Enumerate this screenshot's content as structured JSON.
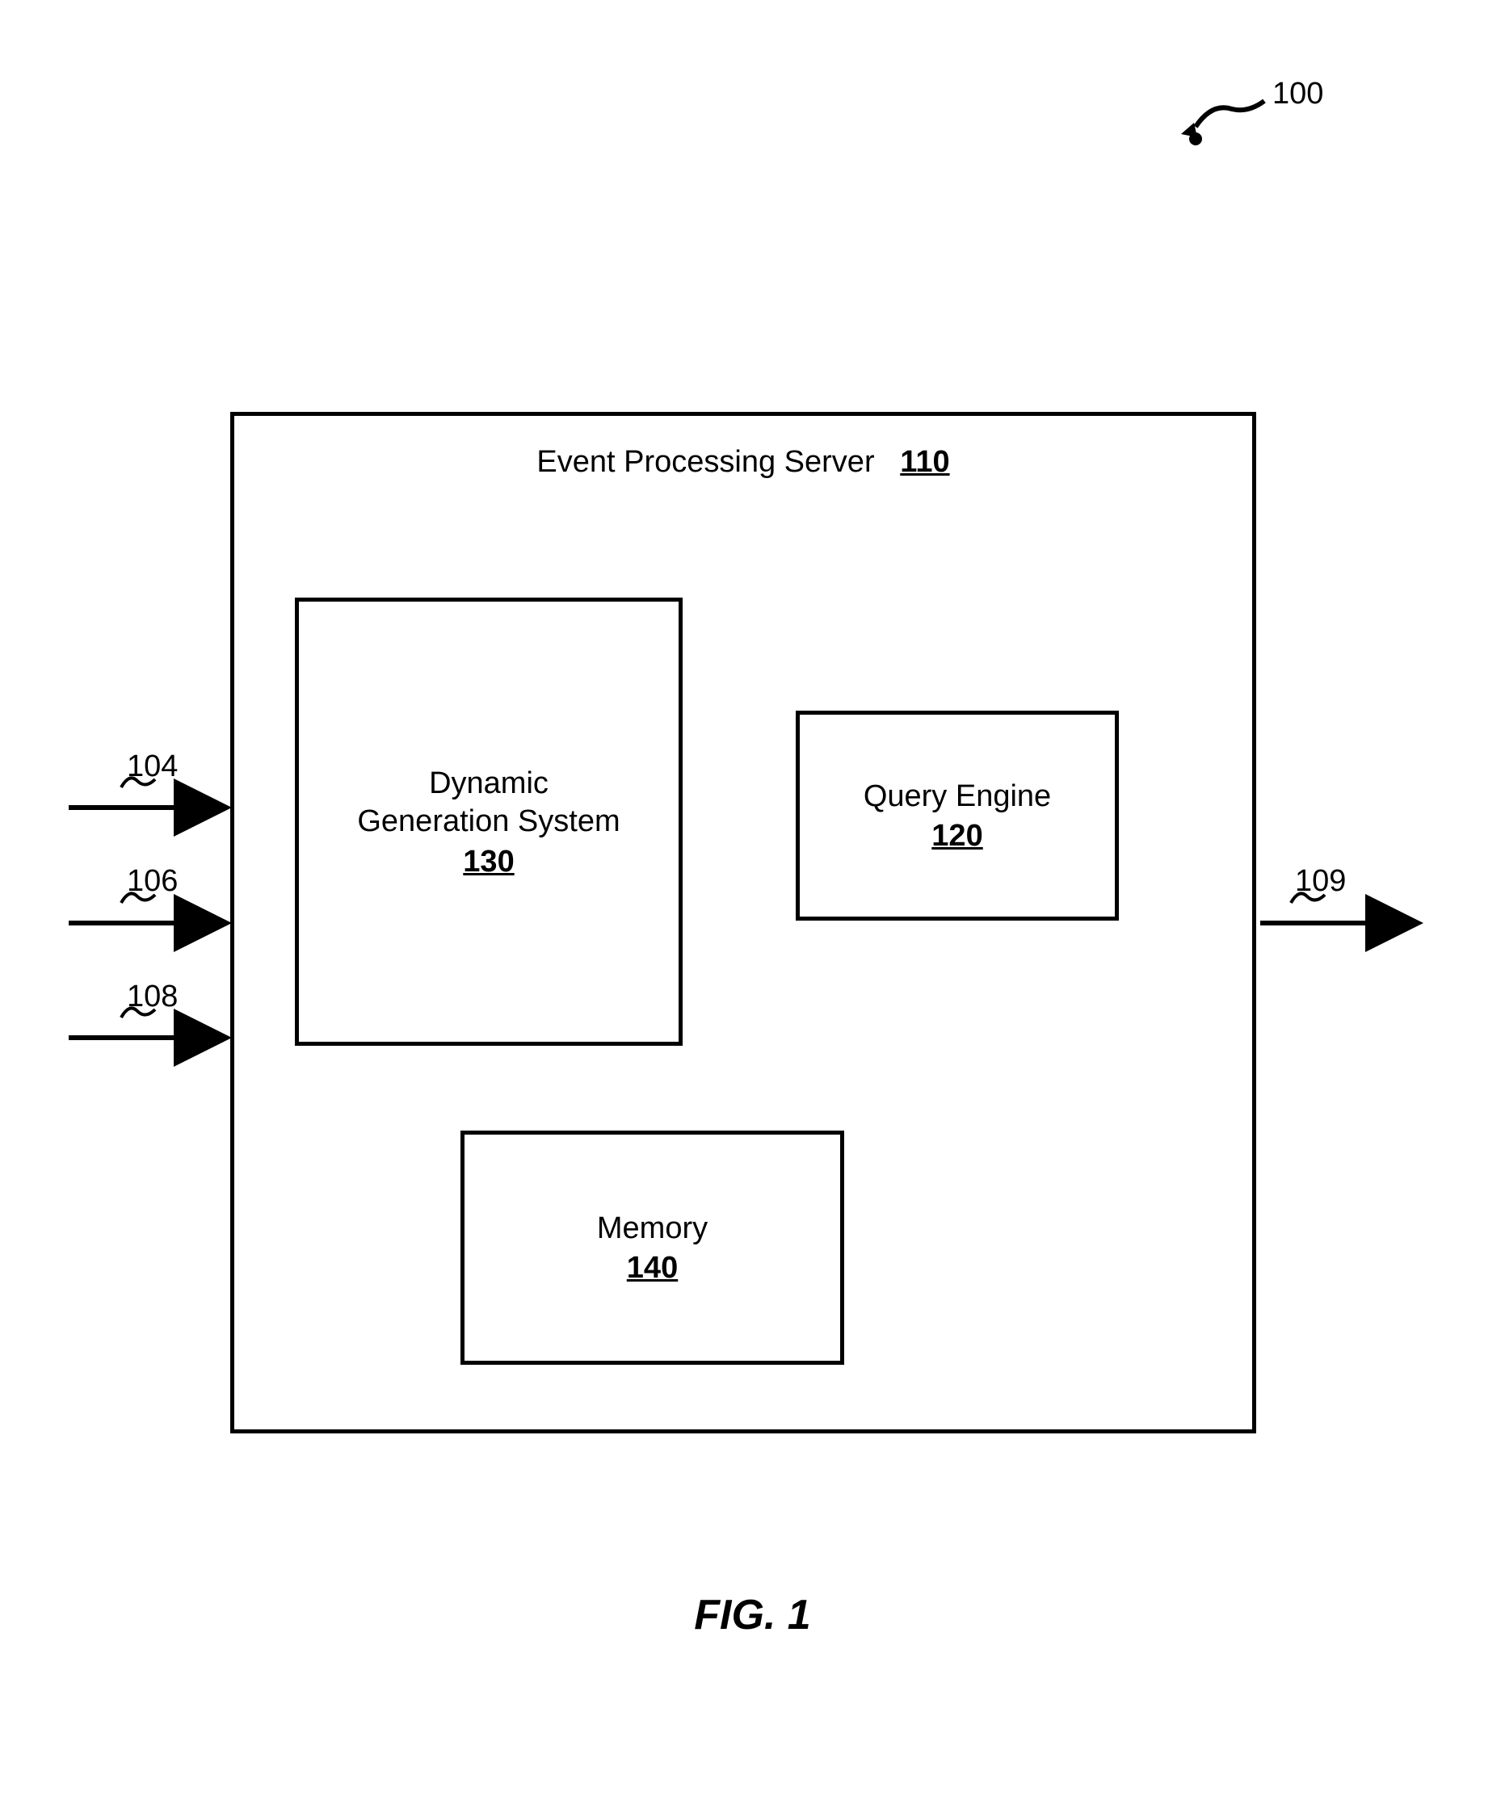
{
  "figure_ref": "100",
  "figure_caption": "FIG. 1",
  "server": {
    "title": "Event Processing Server",
    "ref": "110"
  },
  "blocks": {
    "dynamic": {
      "line1": "Dynamic",
      "line2": "Generation System",
      "ref": "130"
    },
    "query": {
      "line1": "Query Engine",
      "ref": "120"
    },
    "memory": {
      "line1": "Memory",
      "ref": "140"
    }
  },
  "arrows": {
    "in1": "104",
    "in2": "106",
    "in3": "108",
    "out": "109"
  }
}
